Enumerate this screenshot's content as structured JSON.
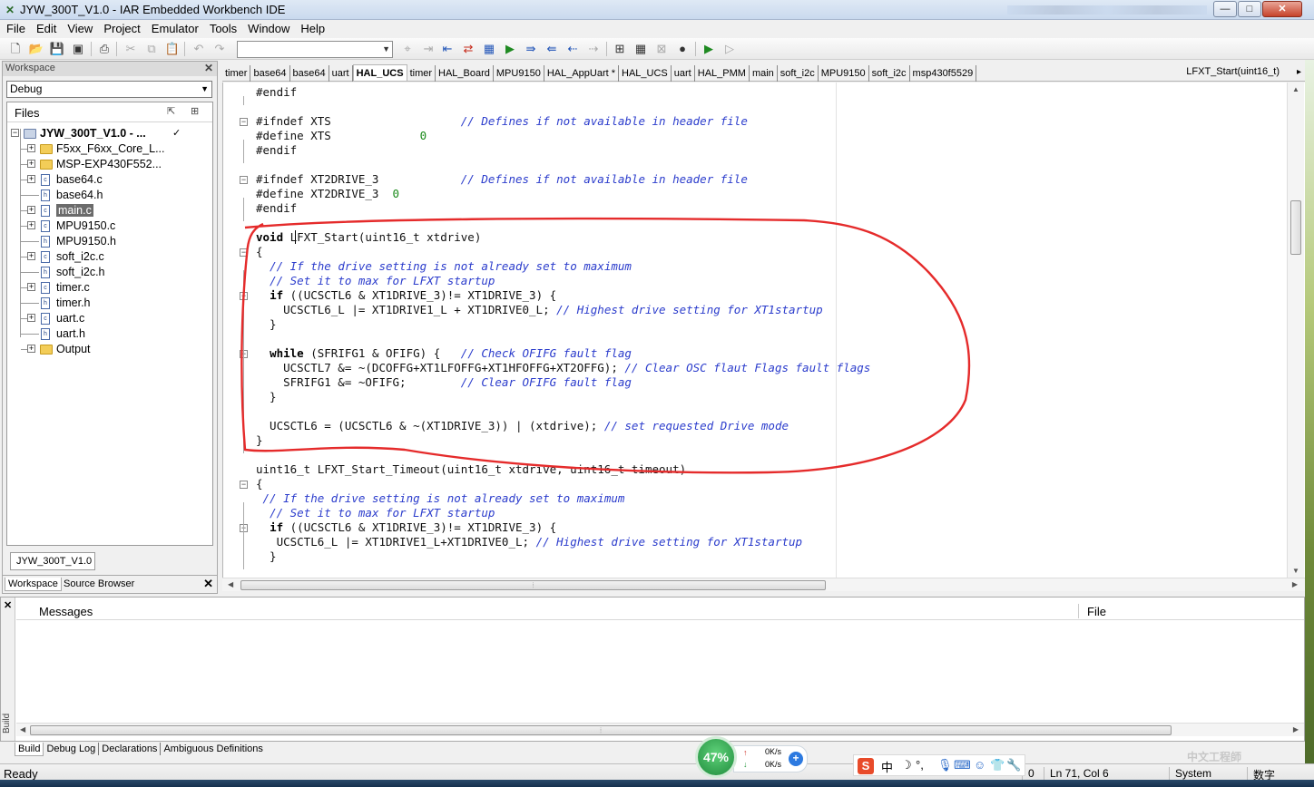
{
  "window": {
    "title": "JYW_300T_V1.0 - IAR Embedded Workbench IDE",
    "min": "—",
    "max": "□",
    "close": "✕"
  },
  "menu": [
    "File",
    "Edit",
    "View",
    "Project",
    "Emulator",
    "Tools",
    "Window",
    "Help"
  ],
  "workspace": {
    "header": "Workspace",
    "close": "✕",
    "config": "Debug",
    "files_header": "Files",
    "project": "JYW_300T_V1.0 - ...",
    "project_check": "✓",
    "tree": [
      {
        "label": "F5xx_F6xx_Core_L...",
        "kind": "folder",
        "exp": "+"
      },
      {
        "label": "MSP-EXP430F552...",
        "kind": "folder",
        "exp": "+"
      },
      {
        "label": "base64.c",
        "kind": "file",
        "exp": "+"
      },
      {
        "label": "base64.h",
        "kind": "file",
        "exp": ""
      },
      {
        "label": "main.c",
        "kind": "file",
        "exp": "+",
        "selected": true
      },
      {
        "label": "MPU9150.c",
        "kind": "file",
        "exp": "+"
      },
      {
        "label": "MPU9150.h",
        "kind": "file",
        "exp": ""
      },
      {
        "label": "soft_i2c.c",
        "kind": "file",
        "exp": "+"
      },
      {
        "label": "soft_i2c.h",
        "kind": "file",
        "exp": ""
      },
      {
        "label": "timer.c",
        "kind": "file",
        "exp": "+"
      },
      {
        "label": "timer.h",
        "kind": "file",
        "exp": ""
      },
      {
        "label": "uart.c",
        "kind": "file",
        "exp": "+"
      },
      {
        "label": "uart.h",
        "kind": "file",
        "exp": ""
      },
      {
        "label": "Output",
        "kind": "folder",
        "exp": "+"
      }
    ],
    "project_tab": "JYW_300T_V1.0",
    "bottom_tabs": [
      "Workspace",
      "Source Browser"
    ]
  },
  "editor": {
    "tabs": [
      "timer",
      "base64",
      "base64",
      "uart",
      "HAL_UCS",
      "timer",
      "HAL_Board",
      "MPU9150",
      "HAL_AppUart *",
      "HAL_UCS",
      "uart",
      "HAL_PMM",
      "main",
      "soft_i2c",
      "MPU9150",
      "soft_i2c",
      "msp430f5529"
    ],
    "active_tab": 4,
    "function": "LFXT_Start(uint16_t)",
    "lines": [
      {
        "code": "#endif",
        "comment": ""
      },
      {
        "code": "",
        "comment": ""
      },
      {
        "code": "#ifndef XTS                   ",
        "comment": "// Defines if not available in header file"
      },
      {
        "code": "#define XTS             0",
        "comment": ""
      },
      {
        "code": "#endif",
        "comment": ""
      },
      {
        "code": "",
        "comment": ""
      },
      {
        "code": "#ifndef XT2DRIVE_3            ",
        "comment": "// Defines if not available in header file"
      },
      {
        "code": "#define XT2DRIVE_3  0",
        "comment": ""
      },
      {
        "code": "#endif",
        "comment": ""
      },
      {
        "code": "",
        "comment": ""
      },
      {
        "code": "void LFXT_Start(uint16_t xtdrive)",
        "comment": ""
      },
      {
        "code": "{",
        "comment": ""
      },
      {
        "code": "  ",
        "comment": "// If the drive setting is not already set to maximum"
      },
      {
        "code": "  ",
        "comment": "// Set it to max for LFXT startup"
      },
      {
        "code": "  if ((UCSCTL6 & XT1DRIVE_3)!= XT1DRIVE_3) {",
        "comment": ""
      },
      {
        "code": "    UCSCTL6_L |= XT1DRIVE1_L + XT1DRIVE0_L; ",
        "comment": "// Highest drive setting for XT1startup"
      },
      {
        "code": "  }",
        "comment": ""
      },
      {
        "code": "",
        "comment": ""
      },
      {
        "code": "  while (SFRIFG1 & OFIFG) {   ",
        "comment": "// Check OFIFG fault flag"
      },
      {
        "code": "    UCSCTL7 &= ~(DCOFFG+XT1LFOFFG+XT1HFOFFG+XT2OFFG); ",
        "comment": "// Clear OSC flaut Flags fault flags"
      },
      {
        "code": "    SFRIFG1 &= ~OFIFG;        ",
        "comment": "// Clear OFIFG fault flag"
      },
      {
        "code": "  }",
        "comment": ""
      },
      {
        "code": "",
        "comment": ""
      },
      {
        "code": "  UCSCTL6 = (UCSCTL6 & ~(XT1DRIVE_3)) | (xtdrive); ",
        "comment": "// set requested Drive mode"
      },
      {
        "code": "}",
        "comment": ""
      },
      {
        "code": "",
        "comment": ""
      },
      {
        "code": "uint16_t LFXT_Start_Timeout(uint16_t xtdrive, uint16_t timeout)",
        "comment": ""
      },
      {
        "code": "{",
        "comment": ""
      },
      {
        "code": " ",
        "comment": "// If the drive setting is not already set to maximum"
      },
      {
        "code": "  ",
        "comment": "// Set it to max for LFXT startup"
      },
      {
        "code": "  if ((UCSCTL6 & XT1DRIVE_3)!= XT1DRIVE_3) {",
        "comment": ""
      },
      {
        "code": "   UCSCTL6_L |= XT1DRIVE1_L+XT1DRIVE0_L; ",
        "comment": "// Highest drive setting for XT1startup"
      },
      {
        "code": "  }",
        "comment": ""
      }
    ]
  },
  "messages": {
    "col_messages": "Messages",
    "col_file": "File",
    "side_label": "Build",
    "tabs": [
      "Build",
      "Debug Log",
      "Declarations",
      "Ambiguous Definitions"
    ]
  },
  "status": {
    "ready": "Ready",
    "errors": "0",
    "position": "Ln 71, Col 6",
    "encoding": "System",
    "numlock": "数字"
  },
  "net_widget": {
    "percent": "47%",
    "up_speed": "0K/s",
    "down_speed": "0K/s",
    "up_arrow": "↑",
    "down_arrow": "↓",
    "plus": "+"
  },
  "ime": {
    "logo": "S",
    "mode": "中",
    "moon": "☽",
    "punct": "°,"
  },
  "watermark": "中文工程師"
}
